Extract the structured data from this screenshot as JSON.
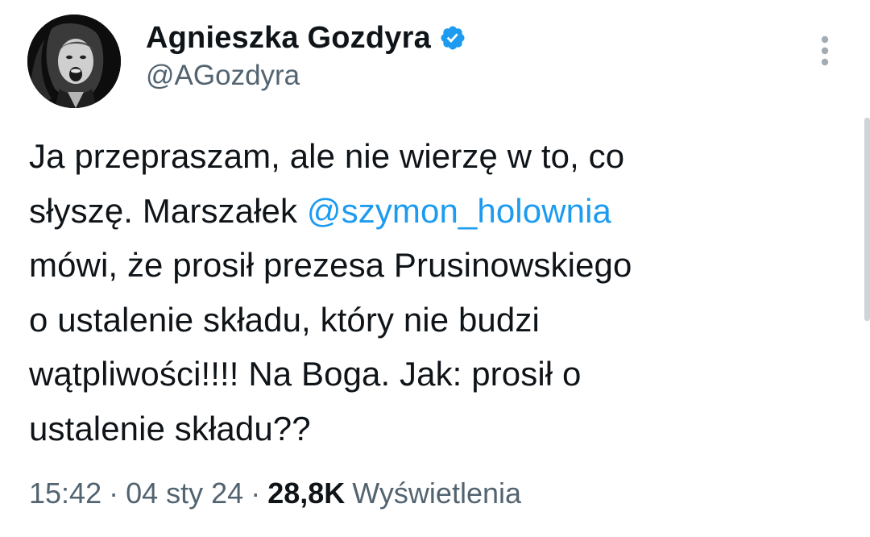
{
  "author": {
    "display_name": "Agnieszka Gozdyra",
    "handle": "@AGozdyra",
    "verified_icon": "verified-badge-icon",
    "avatar": "profile-photo"
  },
  "tweet": {
    "lines": [
      [
        {
          "text": "Ja przepraszam, ale nie wierzę w to, co"
        }
      ],
      [
        {
          "text": "słyszę. Marszałek "
        },
        {
          "text": "@szymon_holownia",
          "mention": true
        }
      ],
      [
        {
          "text": "mówi, że prosił prezesa Prusinowskiego"
        }
      ],
      [
        {
          "text": "o ustalenie składu, który nie budzi"
        }
      ],
      [
        {
          "text": "wątpliwości!!!! Na Boga. Jak: prosił o"
        }
      ],
      [
        {
          "text": "ustalenie składu??"
        }
      ]
    ]
  },
  "meta": {
    "time": "15:42",
    "separator": "·",
    "date": "04 sty 24",
    "views_count": "28,8K",
    "views_label": "Wyświetlenia"
  },
  "colors": {
    "text": "#0f1419",
    "secondary": "#536471",
    "accent": "#1d9bf0"
  }
}
